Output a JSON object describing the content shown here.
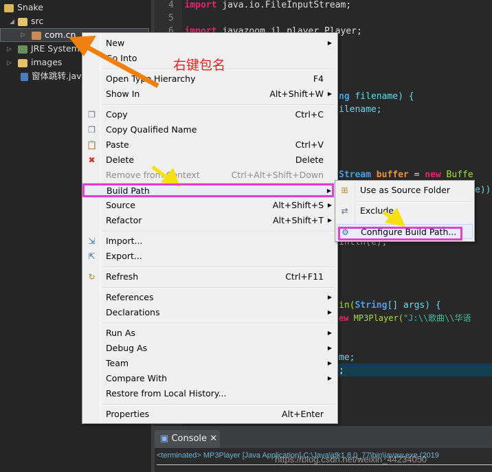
{
  "explorer": {
    "items": [
      {
        "label": "Snake"
      },
      {
        "label": "src"
      },
      {
        "label": "com.cn"
      },
      {
        "label": "JRE System"
      },
      {
        "label": "images"
      },
      {
        "label": "窗体跳转.java"
      }
    ]
  },
  "editor": {
    "lines": [
      {
        "num": "4",
        "kw": "import",
        "text": " java.io.FileInputStream;"
      },
      {
        "num": "5"
      },
      {
        "num": "6",
        "kw": "import",
        "text": " javazoom.jl.player.Player;"
      }
    ],
    "frag": {
      "f1a": "ng",
      "f1b": " filename) {",
      "f2": "ilename;",
      "f3a": "Stream",
      "f3b": "buffer",
      "f3c": " = ",
      "f3d": "new",
      "f3e": " Buffe",
      "f4": "e))",
      "f5": "intln(e);",
      "f6a": "in(",
      "f6b": "String",
      "f6c": "[] args) {",
      "f7a": "ew",
      "f7b": " MP3Player(",
      "f7c": "\"J:\\\\歌曲\\\\华语",
      "f8": "me;",
      "f9": ";"
    }
  },
  "menu": {
    "items": [
      {
        "label": "New",
        "submenu": true
      },
      {
        "label": "Go Into"
      },
      {
        "label": "Open Type Hierarchy",
        "shortcut": "F4"
      },
      {
        "label": "Show In",
        "shortcut": "Alt+Shift+W",
        "submenu": true
      },
      {
        "label": "Copy",
        "shortcut": "Ctrl+C",
        "icon": "copy-icon"
      },
      {
        "label": "Copy Qualified Name",
        "icon": "copy-qualified-icon"
      },
      {
        "label": "Paste",
        "shortcut": "Ctrl+V",
        "icon": "paste-icon"
      },
      {
        "label": "Delete",
        "shortcut": "Delete",
        "icon": "delete-icon"
      },
      {
        "label": "Remove from Context",
        "shortcut": "Ctrl+Alt+Shift+Down",
        "disabled": true
      },
      {
        "label": "Build Path",
        "submenu": true,
        "highlighted": true
      },
      {
        "label": "Source",
        "shortcut": "Alt+Shift+S",
        "submenu": true
      },
      {
        "label": "Refactor",
        "shortcut": "Alt+Shift+T",
        "submenu": true
      },
      {
        "label": "Import...",
        "icon": "import-icon"
      },
      {
        "label": "Export...",
        "icon": "export-icon"
      },
      {
        "label": "Refresh",
        "shortcut": "Ctrl+F11",
        "icon": "refresh-icon"
      },
      {
        "label": "References",
        "submenu": true
      },
      {
        "label": "Declarations",
        "submenu": true
      },
      {
        "label": "Run As",
        "submenu": true
      },
      {
        "label": "Debug As",
        "submenu": true
      },
      {
        "label": "Team",
        "submenu": true
      },
      {
        "label": "Compare With",
        "submenu": true
      },
      {
        "label": "Restore from Local History..."
      },
      {
        "label": "Properties",
        "shortcut": "Alt+Enter"
      }
    ]
  },
  "submenu": {
    "items": [
      {
        "label": "Use as Source Folder"
      },
      {
        "label": "Exclude"
      },
      {
        "label": "Configure Build Path..."
      }
    ]
  },
  "console": {
    "tab": "Console",
    "text": "<terminated> MP3Player [Java Application] C:\\Java\\jdk1.8.0_77\\bin\\javaw.exe (2019"
  },
  "annotation": {
    "note": "右键包名",
    "watermark": "https://blog.csdn.net/weixin_44234050"
  },
  "colors": {
    "highlight_box": "#e040d0",
    "arrow_orange": "#f08010",
    "arrow_yellow": "#f8e010",
    "note": "#e82020"
  }
}
